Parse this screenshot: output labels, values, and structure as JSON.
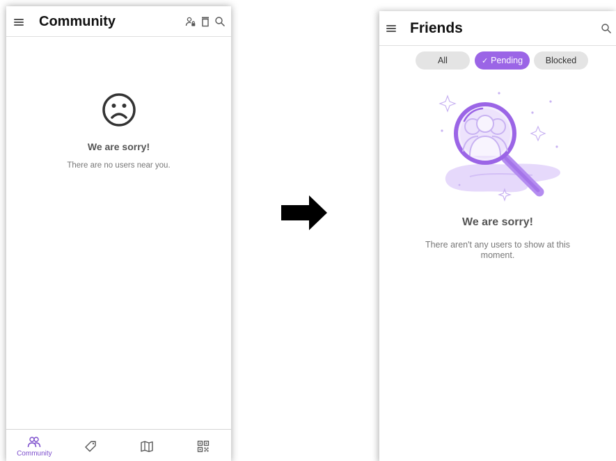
{
  "left_screen": {
    "appbar": {
      "title": "Community",
      "icons": [
        "menu-icon",
        "user-lock-icon",
        "trash-icon",
        "search-icon"
      ]
    },
    "empty_state": {
      "icon": "sad-face-icon",
      "title": "We are sorry!",
      "subtitle": "There are no users near you."
    },
    "bottom_nav": {
      "items": [
        {
          "label": "Community",
          "icon": "people-icon",
          "active": true
        },
        {
          "label": "",
          "icon": "tag-icon",
          "active": false
        },
        {
          "label": "",
          "icon": "map-icon",
          "active": false
        },
        {
          "label": "",
          "icon": "qr-code-icon",
          "active": false
        }
      ]
    }
  },
  "arrow": {
    "icon": "right-arrow-icon"
  },
  "right_screen": {
    "appbar": {
      "title": "Friends",
      "icons": [
        "menu-icon",
        "search-icon"
      ]
    },
    "chips": [
      {
        "label": "All",
        "active": false
      },
      {
        "label": "Pending",
        "active": true,
        "icon": "check-icon"
      },
      {
        "label": "Blocked",
        "active": false
      }
    ],
    "empty_state": {
      "illustration": "magnifier-users-illustration",
      "title": "We are sorry!",
      "subtitle": "There aren't any users to show at this moment."
    }
  },
  "colors": {
    "accent": "#9b65e6",
    "nav_active": "#7c4dcc",
    "chip_inactive": "#e4e4e4",
    "illustration_light": "#e6d9fb"
  }
}
